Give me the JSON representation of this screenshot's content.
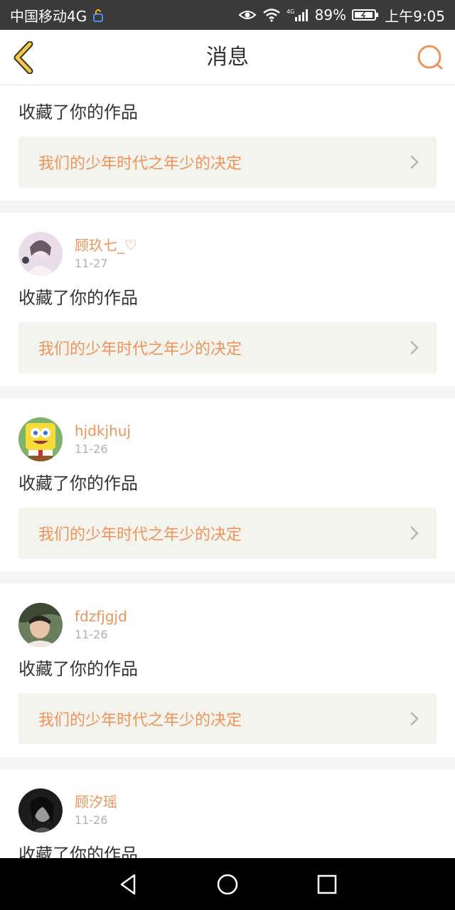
{
  "status_bar": {
    "carrier": "中国移动4G",
    "network": "4G",
    "battery": "89%",
    "time": "上午9:05"
  },
  "header": {
    "title": "消息"
  },
  "colors": {
    "accent": "#f0935a",
    "text": "#333333",
    "date": "#b0b0b0",
    "card_link_bg": "#f4f4ee"
  },
  "messages": [
    {
      "action": "收藏了你的作品",
      "work_title": "我们的少年时代之年少的决定"
    },
    {
      "username": "顾玖七_♡",
      "date": "11-27",
      "action": "收藏了你的作品",
      "work_title": "我们的少年时代之年少的决定"
    },
    {
      "username": "hjdkjhuj",
      "date": "11-26",
      "action": "收藏了你的作品",
      "work_title": "我们的少年时代之年少的决定"
    },
    {
      "username": "fdzfjgjd",
      "date": "11-26",
      "action": "收藏了你的作品",
      "work_title": "我们的少年时代之年少的决定"
    },
    {
      "username": "顾汐瑶",
      "date": "11-26",
      "action": "收藏了你的作品"
    }
  ]
}
